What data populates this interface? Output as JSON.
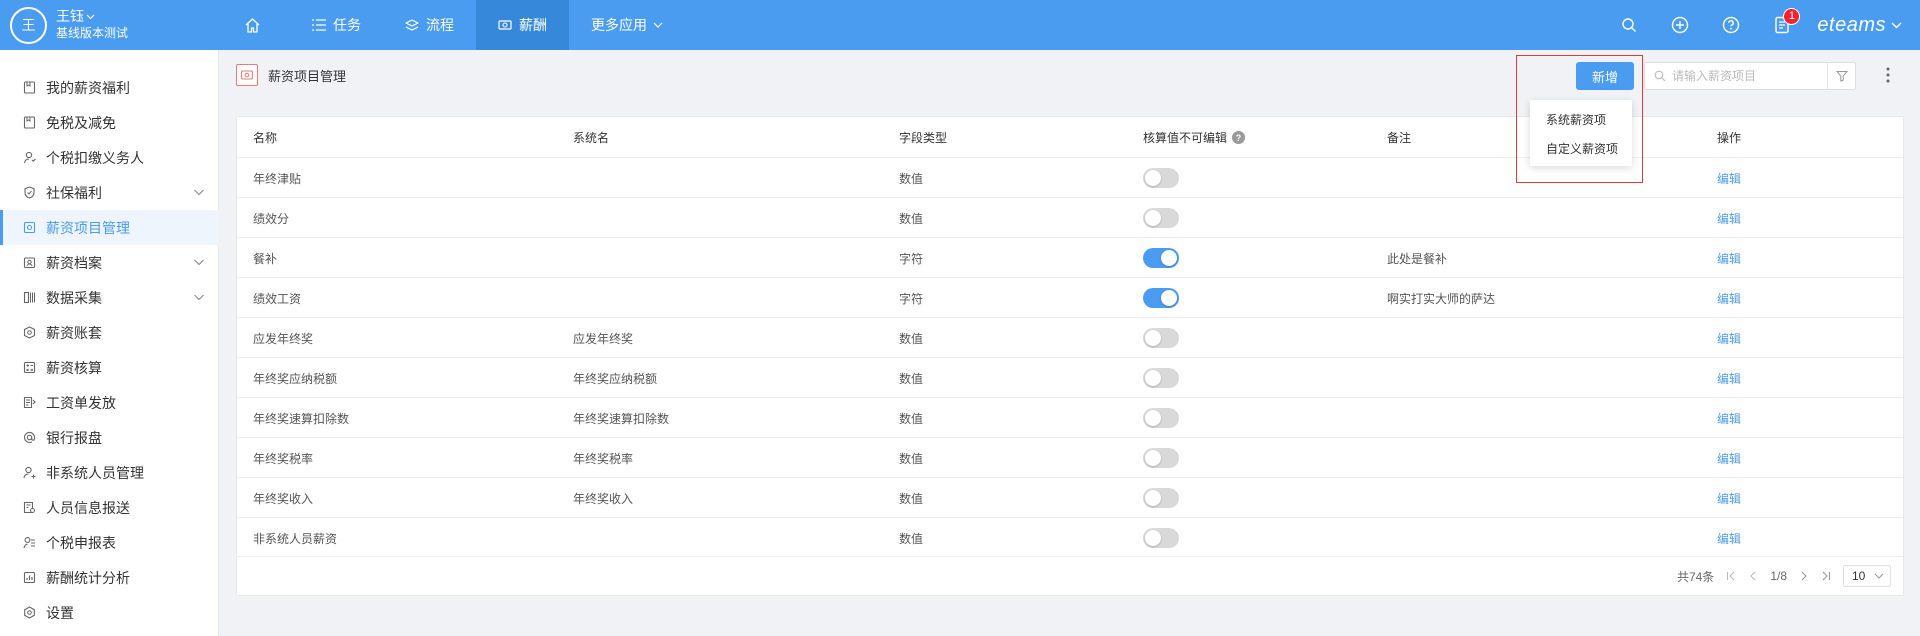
{
  "header": {
    "avatar_text": "王",
    "user_name": "王钰",
    "user_sub": "基线版本测试",
    "nav": [
      {
        "label": "",
        "icon": "home-icon"
      },
      {
        "label": "任务",
        "icon": "list-icon"
      },
      {
        "label": "流程",
        "icon": "layers-icon"
      },
      {
        "label": "薪酬",
        "icon": "money-icon",
        "active": true
      },
      {
        "label": "更多应用",
        "icon": "chevron-down-icon"
      }
    ],
    "notification_count": "1",
    "brand": "eteams"
  },
  "sidebar": {
    "items": [
      {
        "label": "我的薪资福利",
        "icon": "bookmark-icon"
      },
      {
        "label": "免税及减免",
        "icon": "bookmark-icon"
      },
      {
        "label": "个税扣缴义务人",
        "icon": "user-icon"
      },
      {
        "label": "社保福利",
        "icon": "shield-icon",
        "expandable": true
      },
      {
        "label": "薪资项目管理",
        "icon": "salary-item-icon",
        "active": true
      },
      {
        "label": "薪资档案",
        "icon": "archive-icon",
        "expandable": true
      },
      {
        "label": "数据采集",
        "icon": "collect-icon",
        "expandable": true
      },
      {
        "label": "薪资账套",
        "icon": "account-set-icon"
      },
      {
        "label": "薪资核算",
        "icon": "calculate-icon"
      },
      {
        "label": "工资单发放",
        "icon": "payslip-icon"
      },
      {
        "label": "银行报盘",
        "icon": "at-icon"
      },
      {
        "label": "非系统人员管理",
        "icon": "user-manage-icon"
      },
      {
        "label": "人员信息报送",
        "icon": "report-icon"
      },
      {
        "label": "个税申报表",
        "icon": "tax-icon"
      },
      {
        "label": "薪酬统计分析",
        "icon": "stats-icon"
      },
      {
        "label": "设置",
        "icon": "settings-icon"
      }
    ]
  },
  "page": {
    "title": "薪资项目管理",
    "new_button": "新增",
    "search_placeholder": "请输入薪资项目",
    "dropdown": [
      "系统薪资项",
      "自定义薪资项"
    ]
  },
  "table": {
    "columns": [
      "名称",
      "系统名",
      "字段类型",
      "核算值不可编辑",
      "备注",
      "操作"
    ],
    "rows": [
      {
        "name": "年终津贴",
        "sysname": "",
        "type": "数值",
        "locked": false,
        "remark": "",
        "action": "编辑"
      },
      {
        "name": "绩效分",
        "sysname": "",
        "type": "数值",
        "locked": false,
        "remark": "",
        "action": "编辑"
      },
      {
        "name": "餐补",
        "sysname": "",
        "type": "字符",
        "locked": true,
        "remark": "此处是餐补",
        "action": "编辑"
      },
      {
        "name": "绩效工资",
        "sysname": "",
        "type": "字符",
        "locked": true,
        "remark": "啊实打实大师的萨达",
        "action": "编辑"
      },
      {
        "name": "应发年终奖",
        "sysname": "应发年终奖",
        "type": "数值",
        "locked": false,
        "remark": "",
        "action": "编辑"
      },
      {
        "name": "年终奖应纳税额",
        "sysname": "年终奖应纳税额",
        "type": "数值",
        "locked": false,
        "remark": "",
        "action": "编辑"
      },
      {
        "name": "年终奖速算扣除数",
        "sysname": "年终奖速算扣除数",
        "type": "数值",
        "locked": false,
        "remark": "",
        "action": "编辑"
      },
      {
        "name": "年终奖税率",
        "sysname": "年终奖税率",
        "type": "数值",
        "locked": false,
        "remark": "",
        "action": "编辑"
      },
      {
        "name": "年终奖收入",
        "sysname": "年终奖收入",
        "type": "数值",
        "locked": false,
        "remark": "",
        "action": "编辑"
      },
      {
        "name": "非系统人员薪资",
        "sysname": "",
        "type": "数值",
        "locked": false,
        "remark": "",
        "action": "编辑"
      }
    ]
  },
  "pagination": {
    "total": "共74条",
    "page": "1/8",
    "page_size": "10"
  },
  "colors": {
    "primary": "#4a9cf0",
    "header_active": "#3688db",
    "badge": "#f5222d",
    "highlight_box": "#e53935"
  }
}
